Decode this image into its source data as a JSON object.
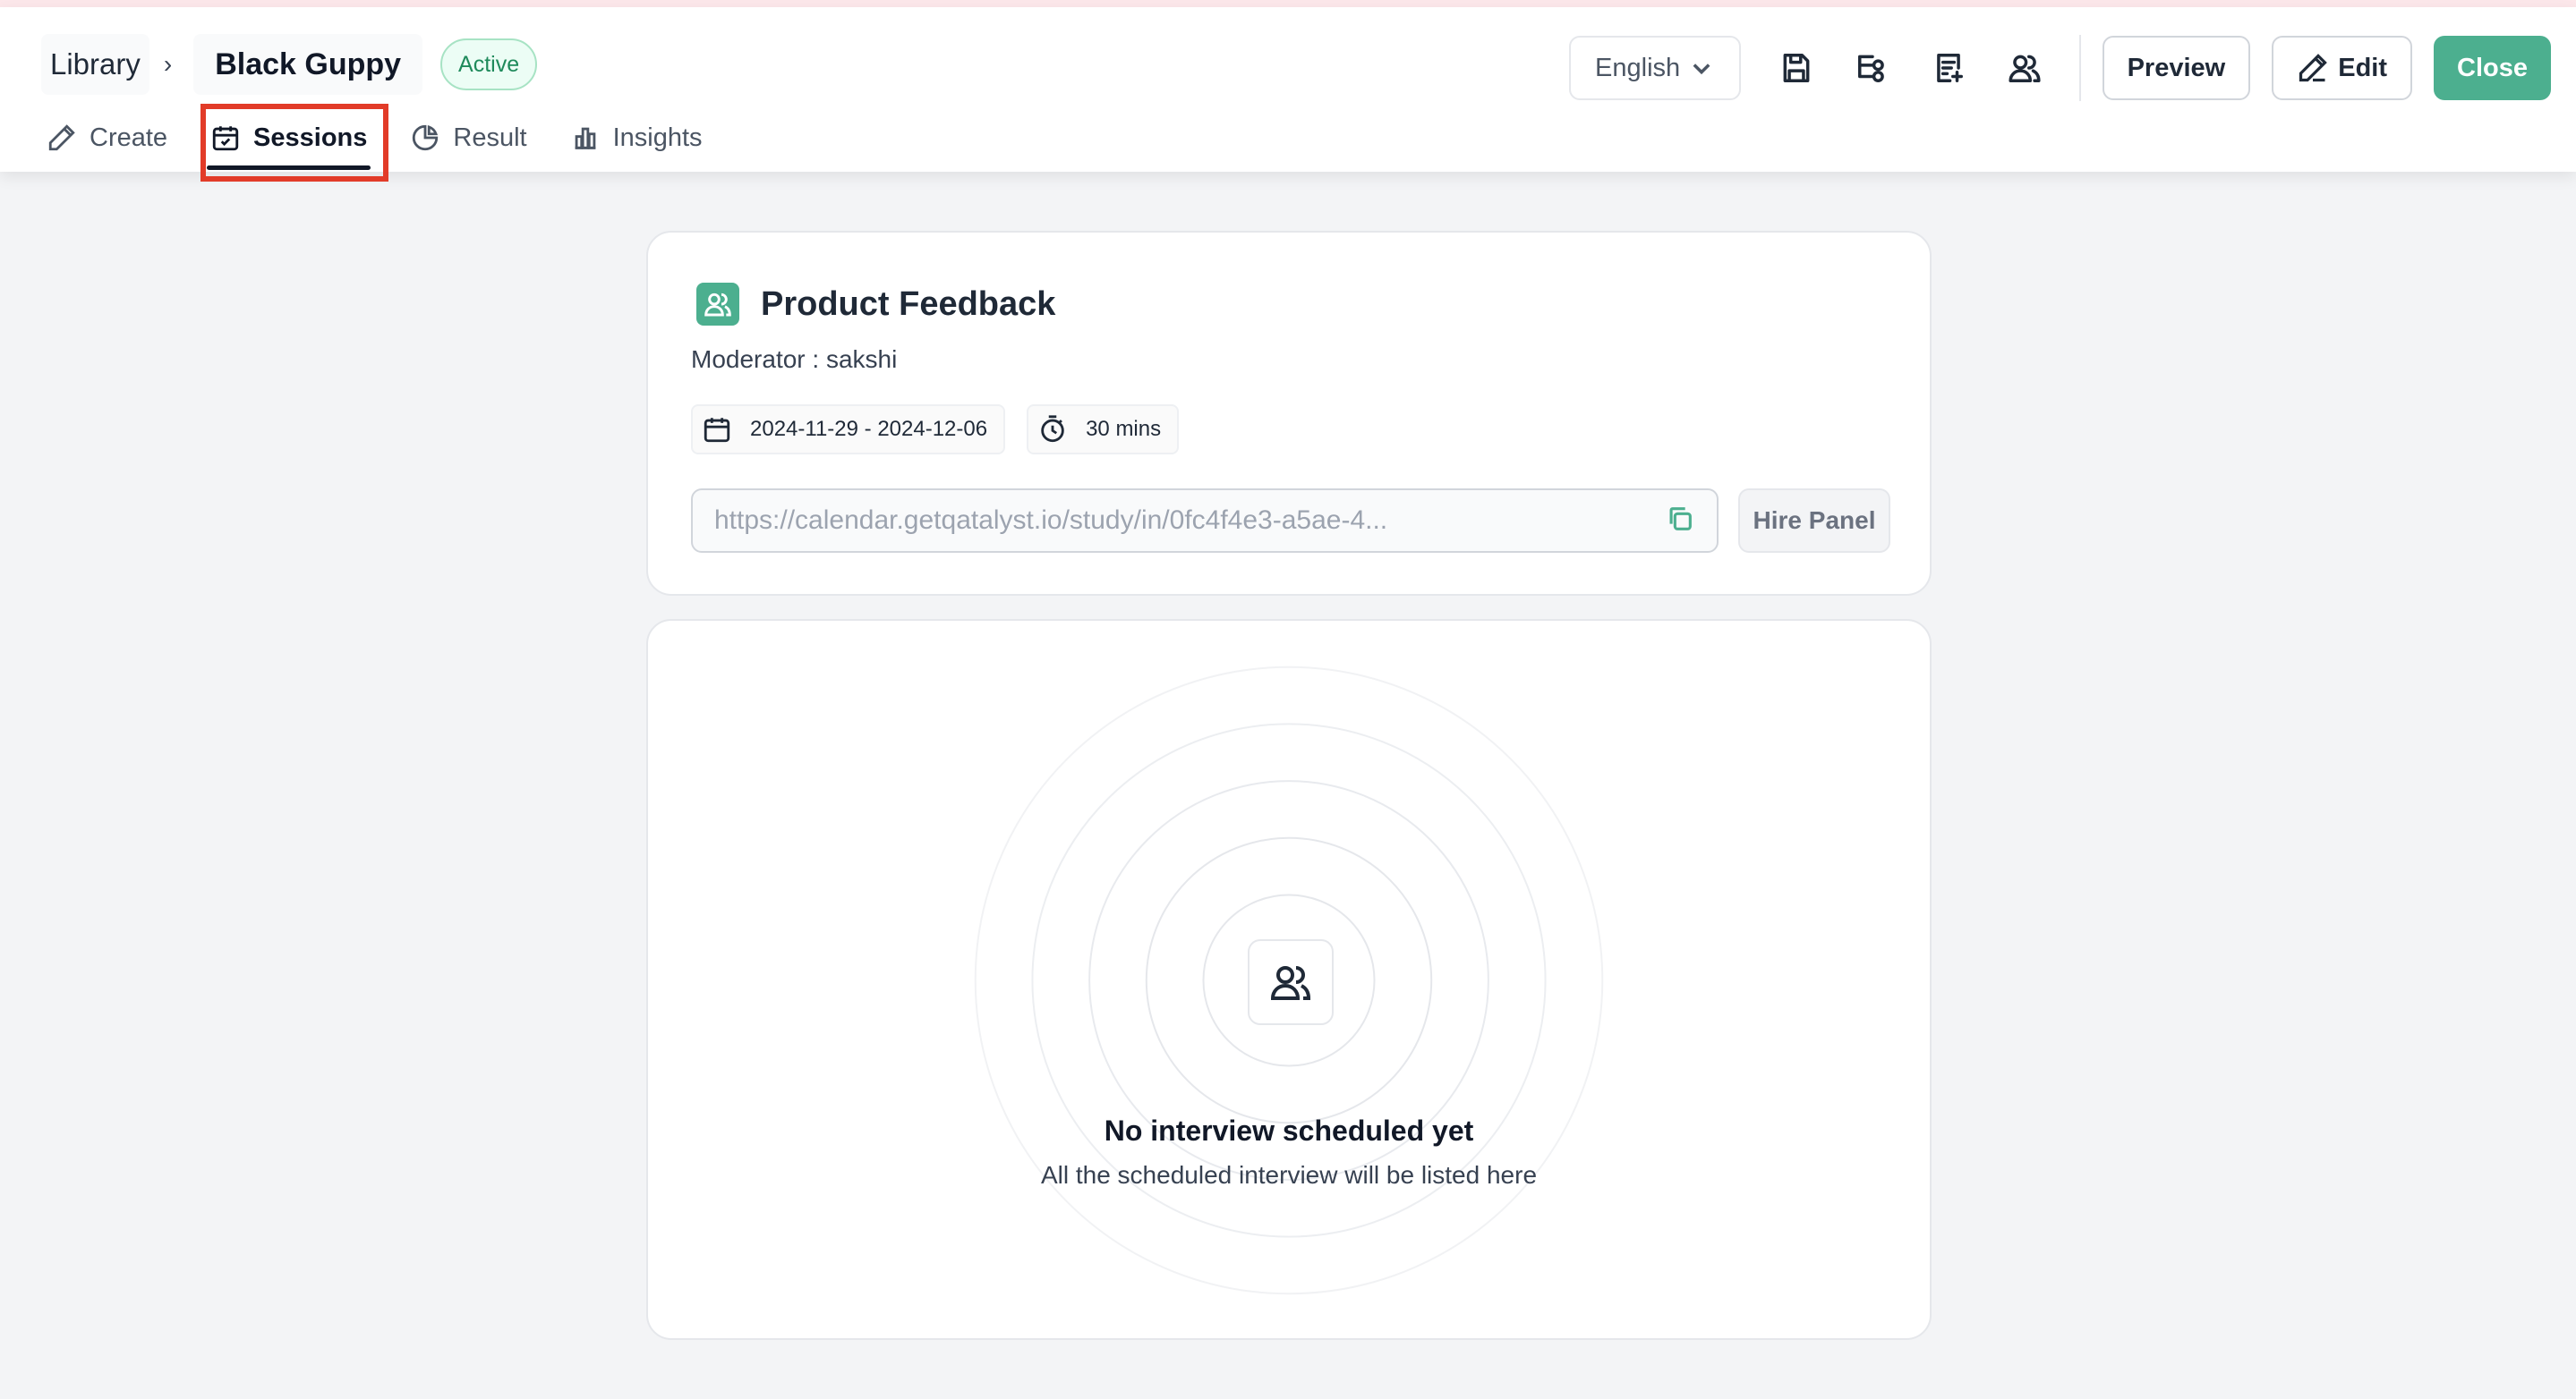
{
  "breadcrumb": {
    "library": "Library",
    "separator": "›",
    "current": "Black Guppy"
  },
  "status": "Active",
  "tabs": [
    {
      "label": "Create",
      "icon": "pencil-icon"
    },
    {
      "label": "Sessions",
      "icon": "calendar-check-icon",
      "active": true
    },
    {
      "label": "Result",
      "icon": "pie-chart-icon"
    },
    {
      "label": "Insights",
      "icon": "bar-chart-icon"
    }
  ],
  "toolbar": {
    "language": "English",
    "icons": [
      "save-icon",
      "workflow-icon",
      "document-add-icon",
      "users-icon"
    ],
    "preview_label": "Preview",
    "edit_label": "Edit",
    "close_label": "Close"
  },
  "study": {
    "title": "Product Feedback",
    "moderator": "Moderator : sakshi",
    "date_range": "2024-11-29 - 2024-12-06",
    "duration": "30 mins",
    "link": "https://calendar.getqatalyst.io/study/in/0fc4f4e3-a5ae-4...",
    "hire_label": "Hire Panel"
  },
  "empty_state": {
    "title": "No interview scheduled yet",
    "subtitle": "All the scheduled interview will be listed here"
  },
  "colors": {
    "accent": "#4caf8f",
    "highlight": "#e23b28",
    "badge_text": "#1f8a5b"
  }
}
